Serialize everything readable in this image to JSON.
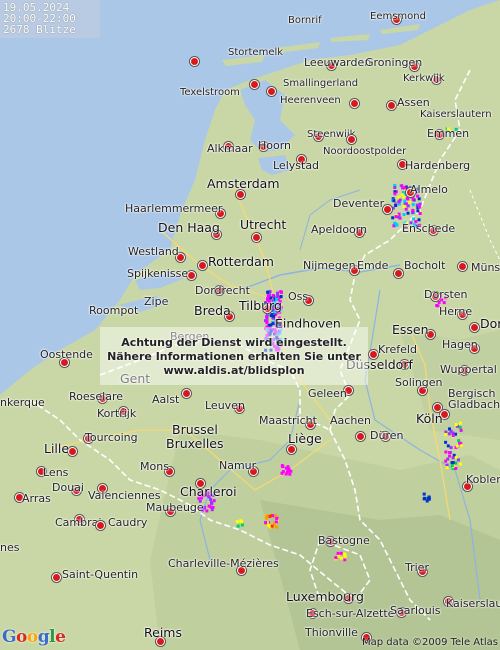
{
  "info": {
    "date": "19.05.2024",
    "time_range": "20:00-22:00",
    "strike_count": "2678 Blitze"
  },
  "notice": {
    "line1": "Achtung der Dienst wird eingestellt.",
    "line2": "Nähere Informationen erhalten Sie unter",
    "line3": "www.aldis.at/blidsplon"
  },
  "google_logo": "Google",
  "credit": "Map data ©2009 Tele Atlas",
  "colors": {
    "land": "#c9d7a6",
    "sea": "#abc7e8",
    "city_dot": "#d8191b",
    "strike_palette": [
      "#ff00ff",
      "#9933ff",
      "#0033cc",
      "#00ccff",
      "#00cc66",
      "#ffff00",
      "#ff9900",
      "#ff3300"
    ]
  },
  "cities": {
    "bornrif": "Bornrif",
    "eemsmond": "Eemsmond",
    "stortemelk": "Stortemelk",
    "leeuwarden": "Leeuwarden",
    "groningen": "Groningen",
    "kerkwijk": "Kerkwijk",
    "smallingerland": "Smallingerland",
    "texelstroom": "Texelstroom",
    "heerenveen": "Heerenveen",
    "assen": "Assen",
    "kaiserslautern_n": "Kaiserslautern",
    "steenwijk": "Steenwijk",
    "noordoostpolder": "Noordoostpolder",
    "emmen": "Emmen",
    "alkmaar": "Alkmaar",
    "hoorn": "Hoorn",
    "lelystad": "Lelystad",
    "hardenberg": "Hardenberg",
    "amsterdam": "Amsterdam",
    "almelo": "Almelo",
    "haarlemmermeer": "Haarlemmermeer",
    "deventer": "Deventer",
    "enschede": "Enschede",
    "den_haag": "Den Haag",
    "utrecht": "Utrecht",
    "apeldoorn": "Apeldoorn",
    "westland": "Westland",
    "rotterdam": "Rotterdam",
    "nijmegen": "Nijmegen",
    "emde": "Emde",
    "bocholt": "Bocholt",
    "munster": "Münste",
    "spijkenisse": "Spijkenisse",
    "oss": "Oss",
    "zipe": "Zipe",
    "dordrecht": "Dordrecht",
    "dorsten": "Dorsten",
    "roompot": "Roompot",
    "breda": "Breda",
    "tilburg": "Tilburg",
    "eindhoven": "Eindhoven",
    "herne": "Herne",
    "bergen": "Bergen",
    "essen": "Essen",
    "dortmund": "Dor",
    "oostende": "Oostende",
    "krefeld": "Krefeld",
    "dusseldorf": "Düsseldorf",
    "hagen": "Hagen",
    "gent": "Gent",
    "wuppertal": "Wuppertal",
    "solingen": "Solingen",
    "dunkerque": "nkerque",
    "roeselare": "Roeselare",
    "aalst": "Aalst",
    "geleen": "Geleen",
    "bergisch_gladbach": "Bergisch\nGladbach",
    "kortrijk": "Kortrijk",
    "leuven": "Leuven",
    "brussel": "Brussel",
    "bruxelles": "Bruxelles",
    "maastricht": "Maastricht",
    "aachen": "Aachen",
    "koln": "Köln",
    "tourcoing": "Tourcoing",
    "duren": "Düren",
    "lille": "Lille",
    "liege": "Liège",
    "koblenz": "Koblenz",
    "lens": "Lens",
    "mons": "Mons",
    "namur": "Namur",
    "charleroi": "Charleroi",
    "valenciennes": "Valenciennes",
    "douai": "Douai",
    "arras": "Arras",
    "cambrai": "Cambrai",
    "maubeuge": "Maubeuge",
    "caudry": "Caudry",
    "nes": "nes",
    "charleville": "Charleville-Mézières",
    "trier": "Trier",
    "saint_quentin": "Saint-Quentin",
    "bastogne": "Bastogne",
    "luxembourg": "Luxembourg",
    "kaiserslautern": "Kaiserslautern",
    "esch": "Esch-sur-Alzette",
    "reims": "Reims",
    "thionville": "Thionville",
    "saarlouis": "Saarlouis"
  }
}
